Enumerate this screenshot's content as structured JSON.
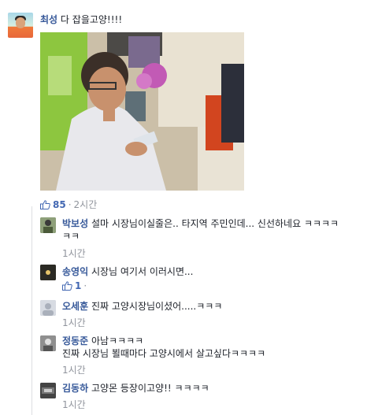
{
  "post": {
    "author": "최성",
    "message": "다 잡을고양!!!!",
    "likes": "85",
    "time": "2시간"
  },
  "replies": [
    {
      "author": "박보성",
      "text_line1": "설마 시장님이실줄은.. 타지역 주민인데... 신선하네요 ㅋㅋㅋㅋ",
      "text_line2": "ㅋㅋ",
      "likes": "",
      "time": "1시간"
    },
    {
      "author": "송영익",
      "text_line1": "시장님 여기서 이러시면...",
      "text_line2": "",
      "likes": "1",
      "time": ""
    },
    {
      "author": "오세훈",
      "text_line1": "진짜 고양시장님이셨어.....ㅋㅋㅋ",
      "text_line2": "",
      "likes": "",
      "time": "1시간"
    },
    {
      "author": "정동준",
      "text_line1": "아남ㅋㅋㅋㅋ",
      "text_line2": "진짜 시장님 뵐때마다 고양시에서 살고싶다ㅋㅋㅋㅋ",
      "likes": "",
      "time": "1시간"
    },
    {
      "author": "김동하",
      "text_line1": "고양몬 등장이고양!! ㅋㅋㅋㅋ",
      "text_line2": "",
      "likes": "",
      "time": "1시간"
    }
  ],
  "icons": {
    "like": "thumbs-up-icon"
  },
  "colors": {
    "name": "#365899",
    "like": "#4267b2",
    "meta": "#90949c"
  }
}
